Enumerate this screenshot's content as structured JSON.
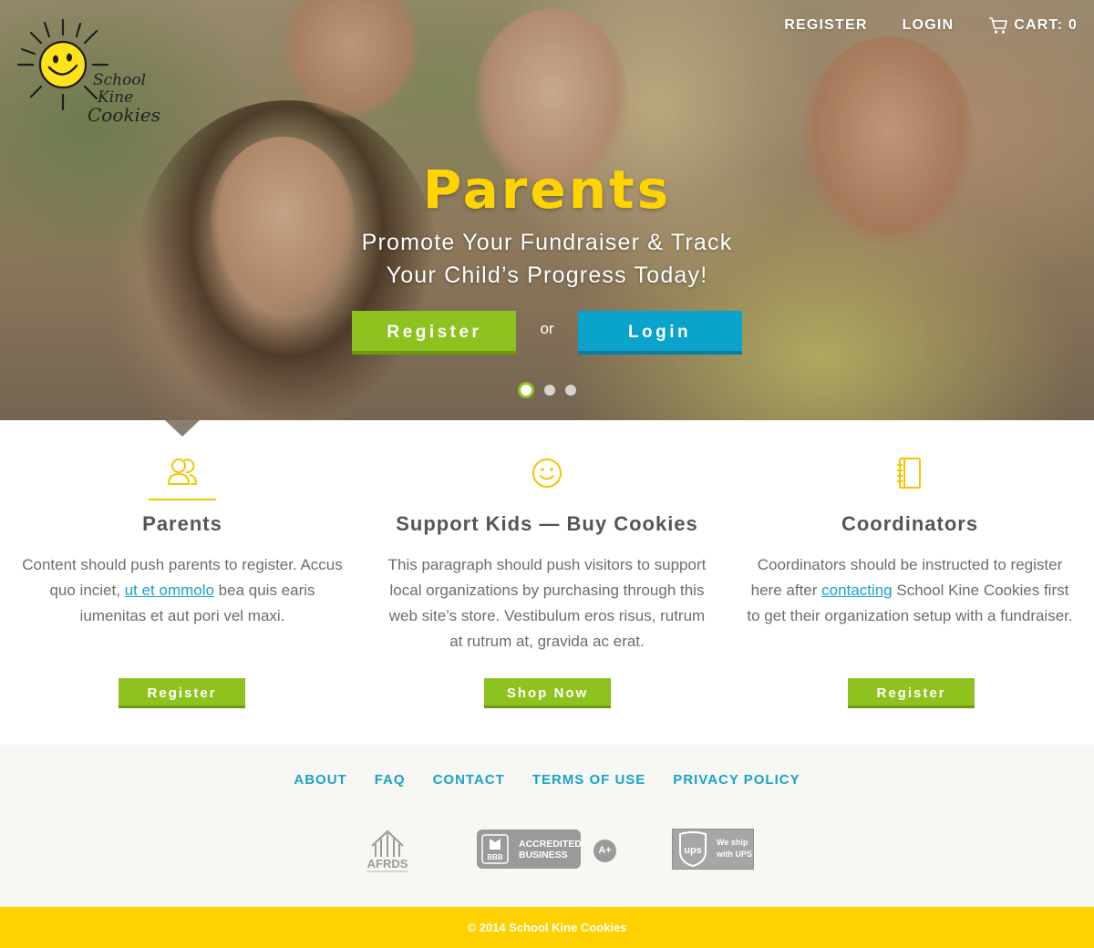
{
  "brand": {
    "logo_lines": [
      "School",
      "Kine",
      "Cookies"
    ]
  },
  "topnav": {
    "register": "REGISTER",
    "login": "LOGIN",
    "cart": "CART: 0"
  },
  "hero": {
    "title": "Parents",
    "subtitle_line1": "Promote Your Fundraiser & Track",
    "subtitle_line2": "Your Child’s Progress Today!",
    "register_button": "Register",
    "or_text": "or",
    "login_button": "Login",
    "slides": 3,
    "active_slide": 1
  },
  "features": [
    {
      "icon": "users-icon",
      "title": "Parents",
      "text_before": "Content should push parents to register. Accus quo inciet, ",
      "link": "ut et ommolo",
      "text_after": " bea quis earis iumenitas et aut pori vel maxi.",
      "button": "Register"
    },
    {
      "icon": "smiley-icon",
      "title": "Support Kids — Buy Cookies",
      "text": "This paragraph should push visitors to support local organizations by purchasing through this web site’s store. Vestibulum eros risus, rutrum at rutrum at, gravida ac erat.",
      "button": "Shop Now"
    },
    {
      "icon": "notebook-icon",
      "title": "Coordinators",
      "text_before": "Coordinators should be instructed to register here after ",
      "link": "contacting",
      "text_after": " School Kine Cookies first to get their organization setup with a fundraiser.",
      "button": "Register"
    }
  ],
  "footer": {
    "links": [
      "ABOUT",
      "FAQ",
      "CONTACT",
      "TERMS OF USE",
      "PRIVACY POLICY"
    ],
    "badges": {
      "afrds": "AFRDS",
      "bbb_line1": "ACCREDITED",
      "bbb_line2": "BUSINESS",
      "bbb_rating": "A+",
      "ups_line1": "We ship",
      "ups_line2": "with UPS"
    },
    "copyright": "© 2014 School Kine Cookies"
  },
  "colors": {
    "green": "#8ec21f",
    "blue": "#0aa3cc",
    "yellow": "#ffd100",
    "link": "#17a3c8"
  }
}
